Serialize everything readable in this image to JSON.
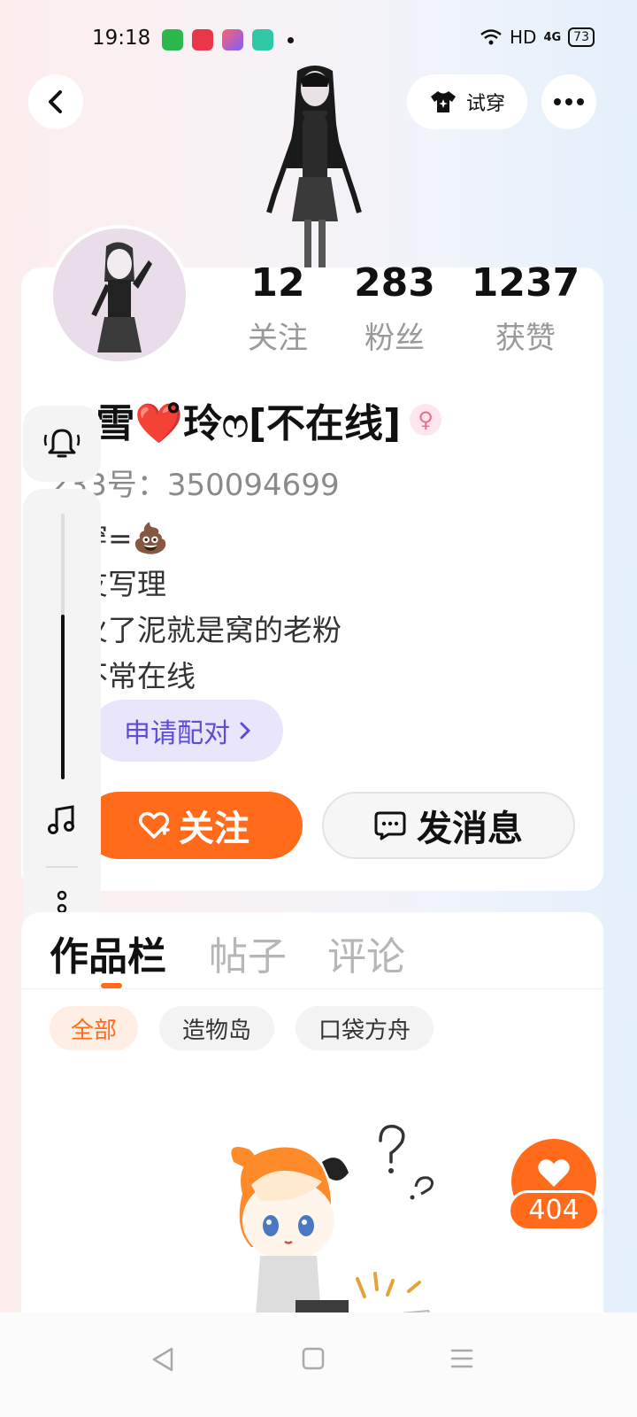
{
  "status_bar": {
    "time": "19:18",
    "network": "HD",
    "signal": "4G",
    "battery": "73"
  },
  "header": {
    "tryon_label": "试穿"
  },
  "stats": [
    {
      "value": "12",
      "label": "关注"
    },
    {
      "value": "283",
      "label": "粉丝"
    },
    {
      "value": "1237",
      "label": "获赞"
    }
  ],
  "profile": {
    "name": "雪❤️̊̊玲ෆ[不在线]",
    "name_prefix": "✨",
    "id_line": "233号：350094699",
    "bio_lines": [
      "试穿=💩",
      "好友写理",
      "窝火了泥就是窝的老粉",
      "学不常在线"
    ],
    "pair_label": "申请配对"
  },
  "actions": {
    "follow_label": "关注",
    "message_label": "发消息"
  },
  "tabs": [
    "作品栏",
    "帖子",
    "评论"
  ],
  "filters": [
    "全部",
    "造物岛",
    "口袋方舟"
  ],
  "like_float": {
    "count": "404"
  },
  "side_panel": {
    "volume_level": 0.62
  },
  "colors": {
    "accent": "#ff6b1a",
    "pair": "#5c4dd6"
  }
}
